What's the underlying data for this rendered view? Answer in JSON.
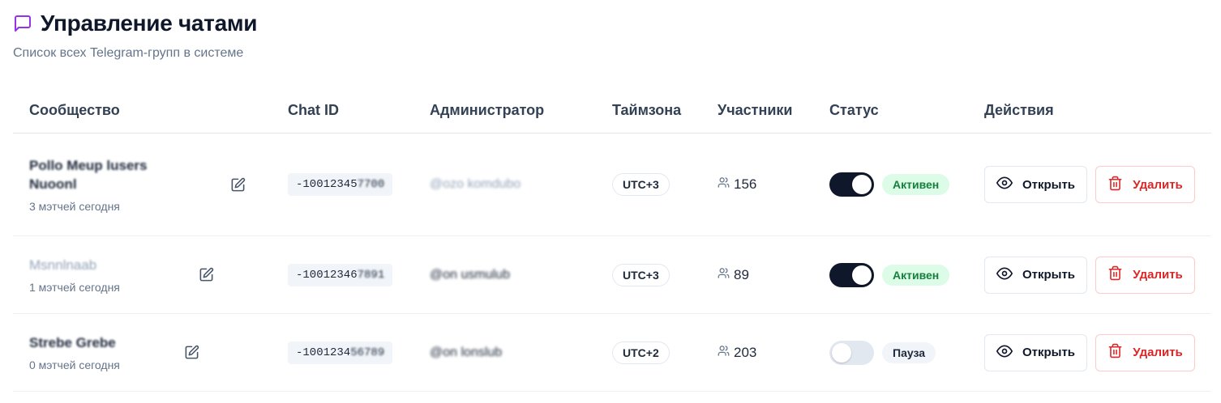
{
  "header": {
    "title": "Управление чатами",
    "subtitle": "Список всех Telegram-групп в системе",
    "icon": "message-square-icon",
    "accent_color": "#9333ea"
  },
  "table": {
    "columns": {
      "community": "Сообщество",
      "chat_id": "Chat ID",
      "admin": "Администратор",
      "timezone": "Таймзона",
      "members": "Участники",
      "status": "Статус",
      "actions": "Действия"
    },
    "rows": [
      {
        "name_line1": "Pollo Meup lusers",
        "name_line2": "Nuoonl",
        "matches": "3 мэтчей сегодня",
        "chat_id_prefix": "-10012345",
        "chat_id_tail": "7700",
        "admin": "@ozo komdubo",
        "timezone": "UTC+3",
        "members": "156",
        "status": "Активен",
        "enabled": true
      },
      {
        "name_line1": "Msnnlnaab",
        "name_line2": "",
        "matches": "1 мэтчей сегодня",
        "chat_id_prefix": "-10012346",
        "chat_id_tail": "7891",
        "admin": "@on usmulub",
        "timezone": "UTC+3",
        "members": "89",
        "status": "Активен",
        "enabled": true
      },
      {
        "name_line1": "Strebe Grebe",
        "name_line2": "",
        "matches": "0 мэтчей сегодня",
        "chat_id_prefix": "-1001234",
        "chat_id_tail": "56789",
        "admin": "@on lonslub",
        "timezone": "UTC+2",
        "members": "203",
        "status": "Пауза",
        "enabled": false
      }
    ]
  },
  "buttons": {
    "open": "Открыть",
    "delete": "Удалить"
  },
  "colors": {
    "active_badge_bg": "#dcfce7",
    "active_badge_text": "#15803d",
    "delete_text": "#dc2626",
    "toggle_on": "#0f172a"
  }
}
